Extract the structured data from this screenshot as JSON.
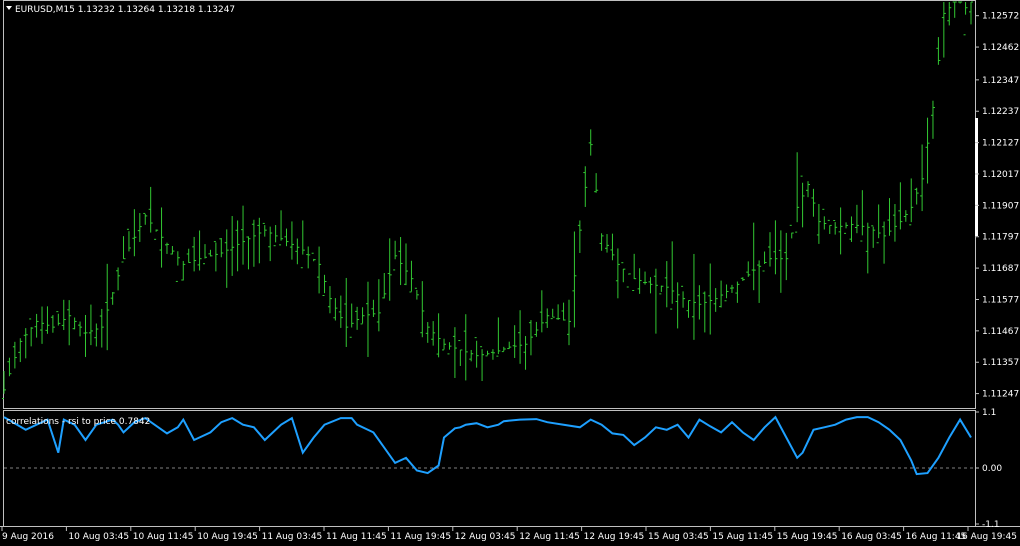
{
  "window": {
    "symbol_header": "EURUSD,M15  1.13232 1.13264 1.13218 1.13247",
    "indicator_header": "correlations - rsi to price 0.7842"
  },
  "colors": {
    "background": "#000000",
    "grid_line": "#c0c0c0",
    "bars": "#32c832",
    "indicator_line": "#1ea0ff",
    "zero_line": "#808080",
    "text": "#ffffff"
  },
  "chart_data": [
    {
      "type": "bar",
      "name": "price",
      "ylim": [
        1.112,
        1.1262
      ],
      "y_ticks": [
        "1.12572",
        "1.12462",
        "1.12347",
        "1.12237",
        "1.12127",
        "1.12017",
        "1.11907",
        "1.11797",
        "1.11687",
        "1.11577",
        "1.11467",
        "1.11357",
        "1.11247"
      ],
      "x_ticks": [
        "9 Aug 2016",
        "10 Aug 03:45",
        "10 Aug 11:45",
        "10 Aug 19:45",
        "11 Aug 03:45",
        "11 Aug 11:45",
        "11 Aug 19:45",
        "12 Aug 03:45",
        "12 Aug 11:45",
        "12 Aug 19:45",
        "15 Aug 03:45",
        "15 Aug 11:45",
        "15 Aug 19:45",
        "16 Aug 03:45",
        "16 Aug 11:45",
        "16 Aug 19:45"
      ],
      "price_path": [
        [
          0,
          1.1126
        ],
        [
          3,
          1.1143
        ],
        [
          6,
          1.115
        ],
        [
          9,
          1.1148
        ],
        [
          12,
          1.1152
        ],
        [
          15,
          1.1146
        ],
        [
          18,
          1.1148
        ],
        [
          22,
          1.1172
        ],
        [
          26,
          1.1187
        ],
        [
          30,
          1.1177
        ],
        [
          33,
          1.117
        ],
        [
          36,
          1.1172
        ],
        [
          40,
          1.1174
        ],
        [
          44,
          1.1178
        ],
        [
          48,
          1.1182
        ],
        [
          52,
          1.1178
        ],
        [
          55,
          1.1175
        ],
        [
          58,
          1.117
        ],
        [
          60,
          1.1158
        ],
        [
          63,
          1.1148
        ],
        [
          66,
          1.1152
        ],
        [
          69,
          1.1153
        ],
        [
          72,
          1.1173
        ],
        [
          75,
          1.1165
        ],
        [
          78,
          1.1148
        ],
        [
          81,
          1.1142
        ],
        [
          84,
          1.114
        ],
        [
          87,
          1.1138
        ],
        [
          90,
          1.1139
        ],
        [
          93,
          1.1141
        ],
        [
          96,
          1.1142
        ],
        [
          100,
          1.1152
        ],
        [
          104,
          1.115
        ],
        [
          106,
          1.1182
        ],
        [
          108,
          1.1212
        ],
        [
          110,
          1.118
        ],
        [
          113,
          1.117
        ],
        [
          116,
          1.1165
        ],
        [
          119,
          1.1163
        ],
        [
          122,
          1.1162
        ],
        [
          125,
          1.1158
        ],
        [
          128,
          1.1156
        ],
        [
          131,
          1.1158
        ],
        [
          135,
          1.1163
        ],
        [
          138,
          1.1168
        ],
        [
          141,
          1.1172
        ],
        [
          144,
          1.1172
        ],
        [
          146,
          1.119
        ],
        [
          148,
          1.1198
        ],
        [
          150,
          1.1185
        ],
        [
          153,
          1.1183
        ],
        [
          156,
          1.1184
        ],
        [
          159,
          1.1183
        ],
        [
          162,
          1.118
        ],
        [
          165,
          1.1185
        ],
        [
          167,
          1.119
        ],
        [
          169,
          1.12
        ],
        [
          171,
          1.1225
        ],
        [
          173,
          1.1258
        ],
        [
          175,
          1.1262
        ],
        [
          176,
          1.1262
        ],
        [
          177,
          1.126
        ],
        [
          178,
          1.1262
        ]
      ]
    },
    {
      "type": "line",
      "name": "correlations - rsi to price",
      "ylim": [
        -1.1,
        1.1
      ],
      "y_ticks": [
        "1.1",
        "0.00",
        "-1.1"
      ],
      "last_value": 0.7842,
      "x": [
        0,
        4,
        8,
        10,
        11,
        13,
        15,
        17,
        20,
        21,
        22,
        24,
        26,
        30,
        32,
        33,
        35,
        38,
        40,
        42,
        44,
        46,
        48,
        51,
        53,
        55,
        57,
        59,
        62,
        64,
        65,
        68,
        72,
        74,
        76,
        78,
        80,
        81,
        83,
        84,
        85,
        87,
        89,
        91,
        92,
        95,
        98,
        100,
        103,
        106,
        108,
        110,
        112,
        114,
        116,
        118,
        120,
        122,
        124,
        126,
        128,
        130,
        132,
        134,
        136,
        138,
        140,
        142,
        144,
        146,
        147,
        149,
        151,
        153,
        155,
        157,
        159,
        161,
        163,
        165,
        167,
        168,
        170,
        172,
        174,
        176,
        178
      ],
      "y": [
        1.0,
        0.75,
        0.95,
        0.3,
        0.95,
        0.85,
        0.55,
        0.85,
        0.95,
        0.85,
        0.7,
        0.9,
        0.98,
        0.68,
        0.8,
        0.95,
        0.55,
        0.7,
        0.9,
        0.98,
        0.85,
        0.8,
        0.55,
        0.85,
        0.98,
        0.3,
        0.6,
        0.85,
        0.98,
        0.98,
        0.85,
        0.7,
        0.1,
        0.2,
        -0.05,
        -0.1,
        0.05,
        0.6,
        0.78,
        0.8,
        0.85,
        0.88,
        0.8,
        0.85,
        0.92,
        0.95,
        0.96,
        0.9,
        0.85,
        0.8,
        0.95,
        0.85,
        0.68,
        0.65,
        0.45,
        0.6,
        0.8,
        0.75,
        0.85,
        0.6,
        0.95,
        0.82,
        0.7,
        0.9,
        0.7,
        0.55,
        0.8,
        1.0,
        0.6,
        0.2,
        0.3,
        0.75,
        0.8,
        0.85,
        0.95,
        1.0,
        1.0,
        0.9,
        0.75,
        0.55,
        0.15,
        -0.12,
        -0.1,
        0.2,
        0.6,
        0.95,
        0.6
      ]
    }
  ]
}
